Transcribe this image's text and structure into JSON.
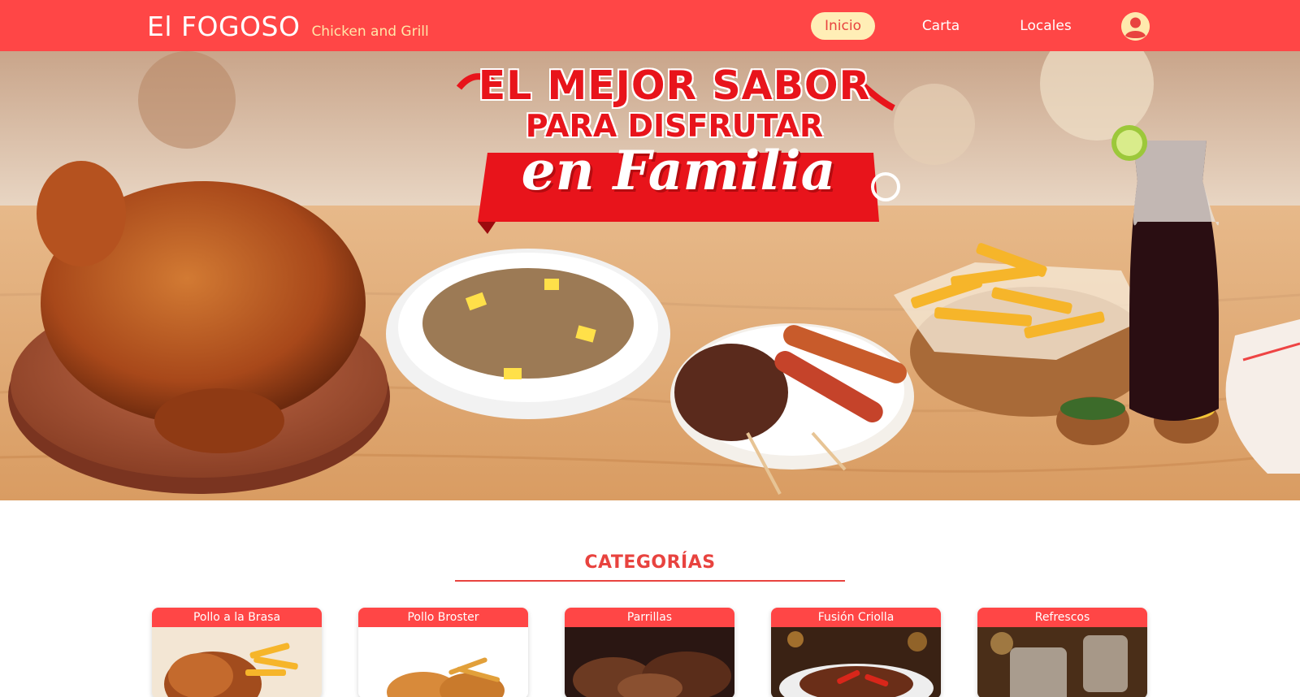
{
  "navbar": {
    "brand_name": "El FOGOSO",
    "brand_tagline": "Chicken and Grill",
    "links": [
      {
        "label": "Inicio",
        "active": true
      },
      {
        "label": "Carta",
        "active": false
      },
      {
        "label": "Locales",
        "active": false
      }
    ],
    "user_icon": "user-circle-icon"
  },
  "hero": {
    "line1": "EL MEJOR SABOR",
    "line2": "PARA DISFRUTAR",
    "line3": "en Familia"
  },
  "categories": {
    "title": "CATEGORÍAS",
    "items": [
      {
        "label": "Pollo a la Brasa"
      },
      {
        "label": "Pollo Broster"
      },
      {
        "label": "Parrillas"
      },
      {
        "label": "Fusión Criolla"
      },
      {
        "label": "Refrescos"
      }
    ]
  },
  "colors": {
    "primary": "#ff4646",
    "accent": "#ffeeb6",
    "heading": "#e8433f"
  }
}
